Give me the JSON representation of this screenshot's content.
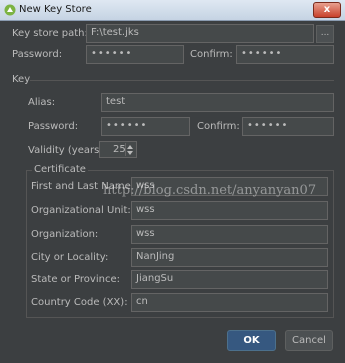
{
  "window": {
    "title": "New Key Store",
    "close_label": "x",
    "app_icon": "android-studio-icon"
  },
  "keystore": {
    "path_label": "Key store path:",
    "path_value": "F:\\test.jks",
    "browse_label": "...",
    "password_label": "Password:",
    "password_value": "••••••",
    "confirm_label": "Confirm:",
    "confirm_value": "••••••"
  },
  "key": {
    "section_label": "Key",
    "alias_label": "Alias:",
    "alias_value": "test",
    "password_label": "Password:",
    "password_value": "••••••",
    "confirm_label": "Confirm:",
    "confirm_value": "••••••",
    "validity_label": "Validity (years):",
    "validity_value": "25"
  },
  "certificate": {
    "section_label": "Certificate",
    "first_last_name_label": "First and Last Name:",
    "first_last_name_value": "wss",
    "org_unit_label": "Organizational Unit:",
    "org_unit_value": "wss",
    "organization_label": "Organization:",
    "organization_value": "wss",
    "city_label": "City or Locality:",
    "city_value": "NanJing",
    "state_label": "State or Province:",
    "state_value": "JiangSu",
    "country_label": "Country Code (XX):",
    "country_value": "cn"
  },
  "buttons": {
    "ok_label": "OK",
    "cancel_label": "Cancel"
  },
  "watermark": "http://blog.csdn.net/anyanyan07"
}
